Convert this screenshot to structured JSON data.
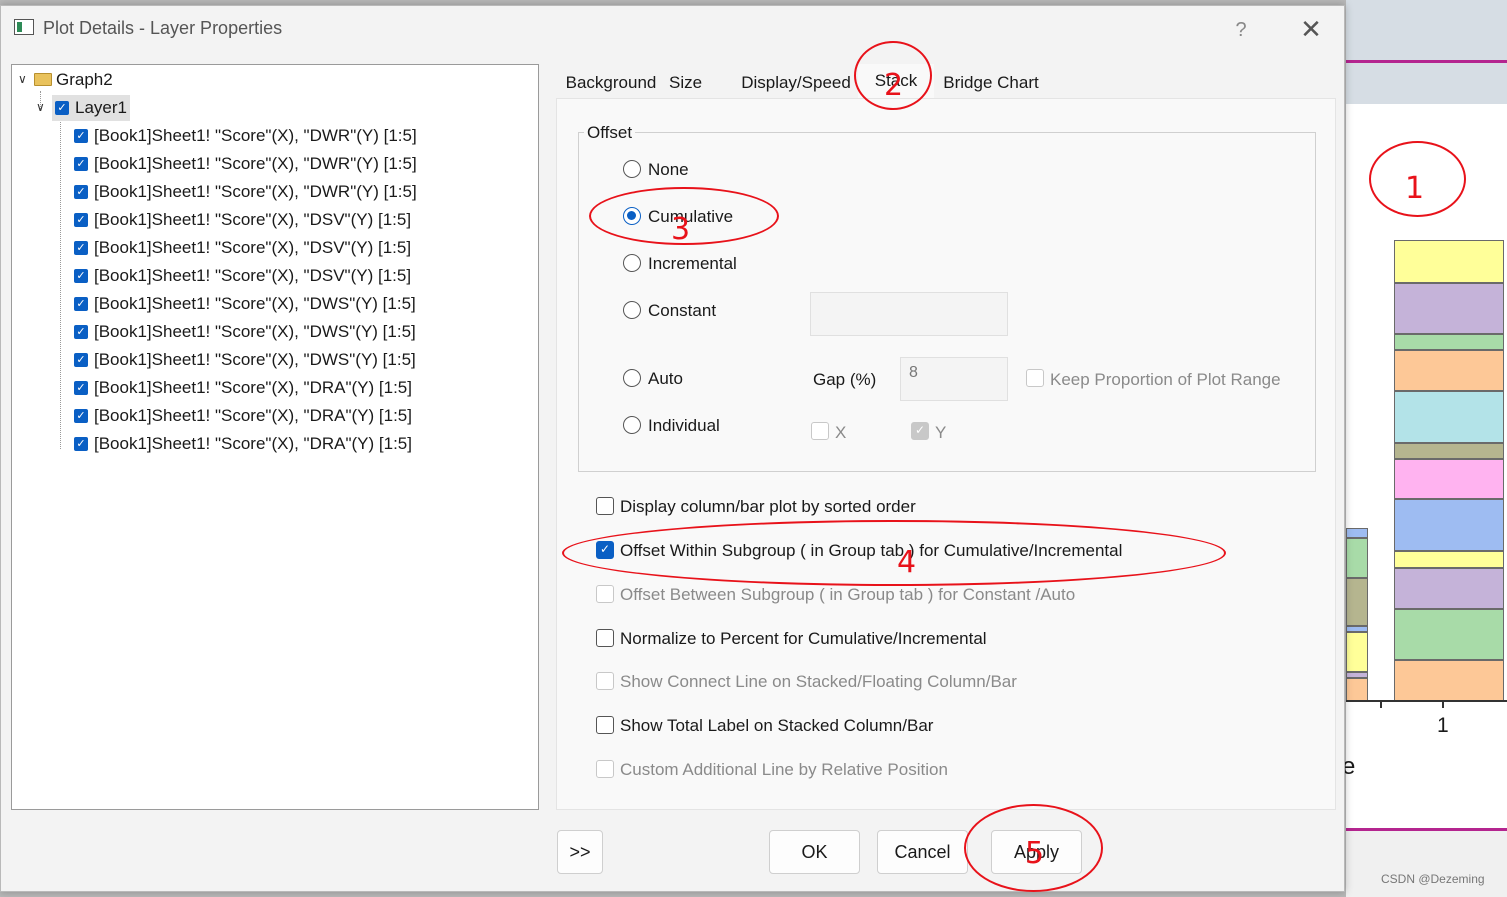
{
  "dialog": {
    "title": "Plot Details - Layer Properties",
    "help_label": "?",
    "close_label": "✕"
  },
  "tree": {
    "graph_label": "Graph2",
    "layer_label": "Layer1",
    "items": [
      "[Book1]Sheet1! \"Score\"(X), \"DWR\"(Y) [1:5]",
      "[Book1]Sheet1! \"Score\"(X), \"DWR\"(Y) [1:5]",
      "[Book1]Sheet1! \"Score\"(X), \"DWR\"(Y) [1:5]",
      "[Book1]Sheet1! \"Score\"(X), \"DSV\"(Y) [1:5]",
      "[Book1]Sheet1! \"Score\"(X), \"DSV\"(Y) [1:5]",
      "[Book1]Sheet1! \"Score\"(X), \"DSV\"(Y) [1:5]",
      "[Book1]Sheet1! \"Score\"(X), \"DWS\"(Y) [1:5]",
      "[Book1]Sheet1! \"Score\"(X), \"DWS\"(Y) [1:5]",
      "[Book1]Sheet1! \"Score\"(X), \"DWS\"(Y) [1:5]",
      "[Book1]Sheet1! \"Score\"(X), \"DRA\"(Y) [1:5]",
      "[Book1]Sheet1! \"Score\"(X), \"DRA\"(Y) [1:5]",
      "[Book1]Sheet1! \"Score\"(X), \"DRA\"(Y) [1:5]"
    ]
  },
  "tabs": [
    "Background",
    "Size",
    "Display/Speed",
    "Stack",
    "Bridge Chart"
  ],
  "offset": {
    "legend": "Offset",
    "none": "None",
    "cumulative": "Cumulative",
    "incremental": "Incremental",
    "constant": "Constant",
    "auto": "Auto",
    "individual": "Individual",
    "gap_label": "Gap (%)",
    "gap_value": "8",
    "keep_proportion": "Keep Proportion of Plot Range",
    "x_label": "X",
    "y_label": "Y"
  },
  "options": {
    "sorted_order": "Display column/bar plot by sorted order",
    "within_subgroup": "Offset Within Subgroup ( in Group tab ) for Cumulative/Incremental",
    "between_subgroup": "Offset Between Subgroup ( in Group tab ) for Constant /Auto",
    "normalize": "Normalize to Percent for Cumulative/Incremental",
    "connect_line": "Show Connect Line on Stacked/Floating Column/Bar",
    "total_label": "Show Total Label on Stacked Column/Bar",
    "custom_line": "Custom Additional Line by Relative Position"
  },
  "buttons": {
    "expand": ">>",
    "ok": "OK",
    "cancel": "Cancel",
    "apply": "Apply"
  },
  "annotations": [
    "1",
    "2",
    "3",
    "4",
    "5"
  ],
  "background_graph": {
    "axis_tick": "1",
    "partial_label": "e"
  },
  "watermark": "CSDN @Dezeming",
  "colors": {
    "accent": "#0a5fc4",
    "annotation_red": "#e8121a",
    "bar_segments": [
      "#ffff99",
      "#c5b3d9",
      "#a8dba8",
      "#fdc897",
      "#b3e3e8",
      "#b5b58f",
      "#ffb3f0",
      "#9ebcf2",
      "#ffff99",
      "#c5b3d9",
      "#a8dba8",
      "#fdc897"
    ]
  }
}
